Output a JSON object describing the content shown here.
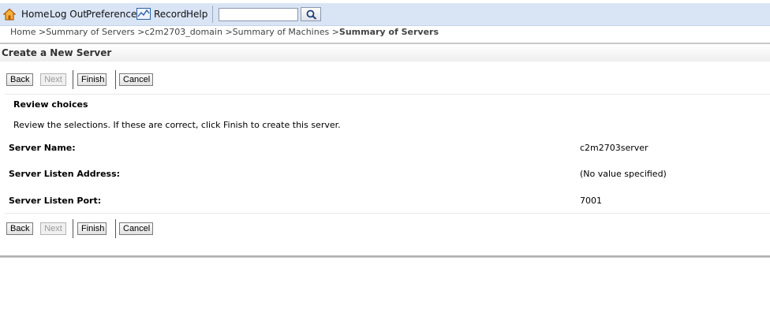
{
  "toolbar": {
    "home": "Home",
    "logout": "Log Out",
    "preferences": "Preferences",
    "record": "Record",
    "help": "Help",
    "search_value": "",
    "icons": [
      "home-icon",
      "record-icon",
      "search-icon"
    ]
  },
  "breadcrumb": {
    "items": [
      "Home",
      "Summary of Servers",
      "c2m2703_domain",
      "Summary of Machines"
    ],
    "current": "Summary of Servers",
    "separator": ">"
  },
  "page": {
    "title": "Create a New Server"
  },
  "buttons": {
    "back": "Back",
    "next": "Next",
    "finish": "Finish",
    "cancel": "Cancel"
  },
  "review": {
    "title": "Review choices",
    "instructions": "Review the selections. If these are correct, click Finish to create this server.",
    "fields": [
      {
        "label": "Server Name:",
        "value": "c2m2703server"
      },
      {
        "label": "Server Listen Address:",
        "value": "(No value specified)"
      },
      {
        "label": "Server Listen Port:",
        "value": "7001"
      }
    ]
  },
  "colors": {
    "toolbar_bg": "#d9e4f5",
    "icon_orange": "#e07a12",
    "icon_blue": "#2b5fa8"
  }
}
